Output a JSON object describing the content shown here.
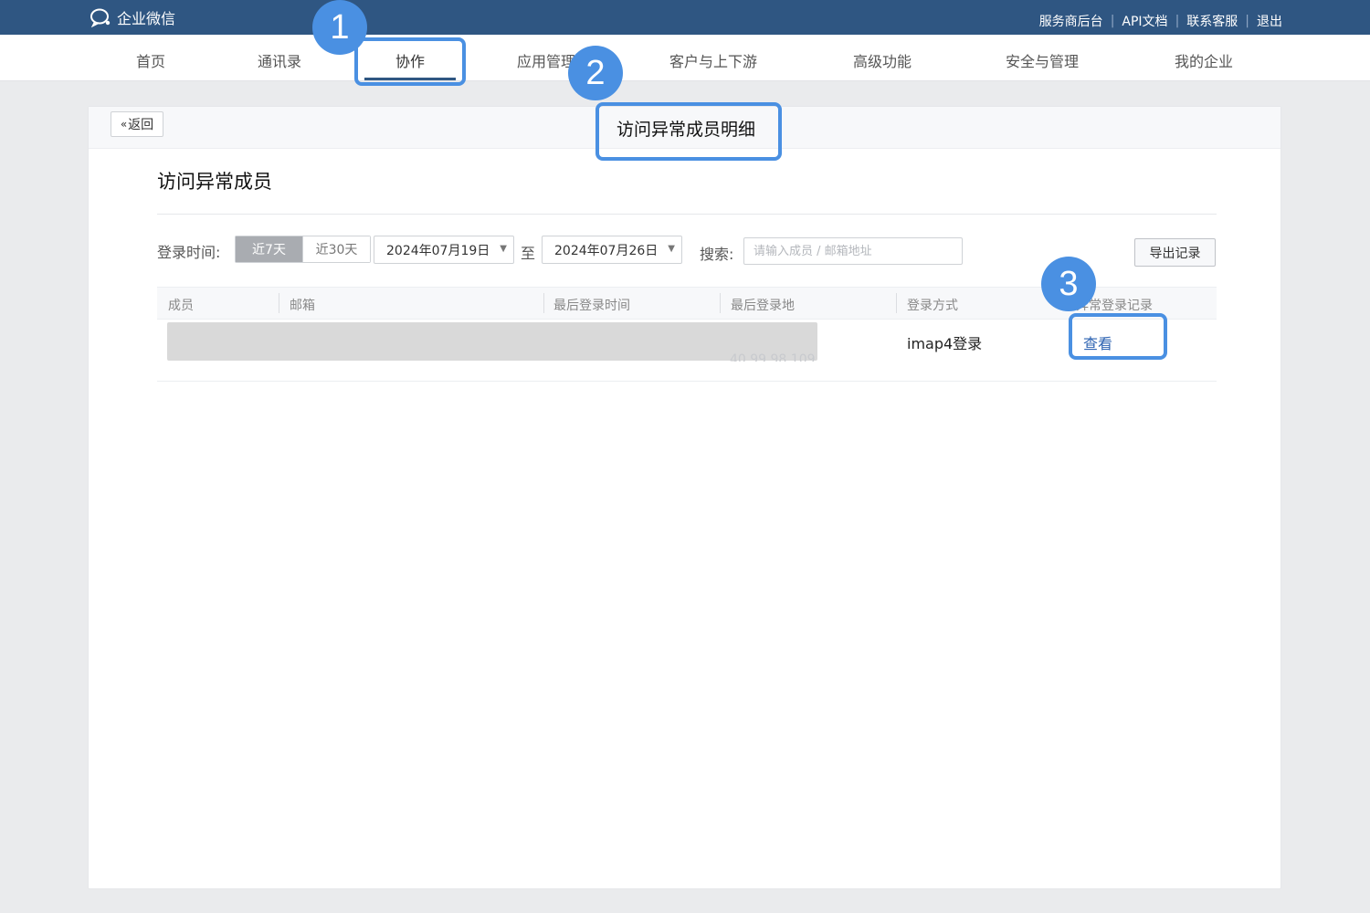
{
  "header": {
    "logo_text": "企业微信",
    "links": [
      "服务商后台",
      "API文档",
      "联系客服",
      "退出"
    ]
  },
  "nav": {
    "items": [
      "首页",
      "通讯录",
      "协作",
      "应用管理",
      "客户与上下游",
      "高级功能",
      "安全与管理",
      "我的企业"
    ],
    "active": "协作"
  },
  "card": {
    "back_label": "返回",
    "title": "访问异常成员明细"
  },
  "section": {
    "title": "访问异常成员"
  },
  "filter": {
    "time_label": "登录时间:",
    "ranges": [
      "近7天",
      "近30天"
    ],
    "selected_range": "近7天",
    "start_date": "2024年07月19日",
    "to_text": "至",
    "end_date": "2024年07月26日",
    "search_label": "搜索:",
    "search_placeholder": "请输入成员 / 邮箱地址",
    "export_label": "导出记录"
  },
  "table": {
    "columns": [
      "成员",
      "邮箱",
      "最后登录时间",
      "最后登录地",
      "登录方式",
      "异常登录记录"
    ],
    "rows": [
      {
        "member": "",
        "email": "",
        "last_login_time": "",
        "last_login_location": "40.99.98.109",
        "login_method": "imap4登录",
        "record_link": "查看"
      }
    ]
  },
  "annotations": {
    "badges": [
      "1",
      "2",
      "3"
    ],
    "color": "#4a90e2"
  },
  "colors": {
    "topbar": "#2f5682",
    "link": "#2d63b2",
    "accent": "#4a90e2"
  }
}
